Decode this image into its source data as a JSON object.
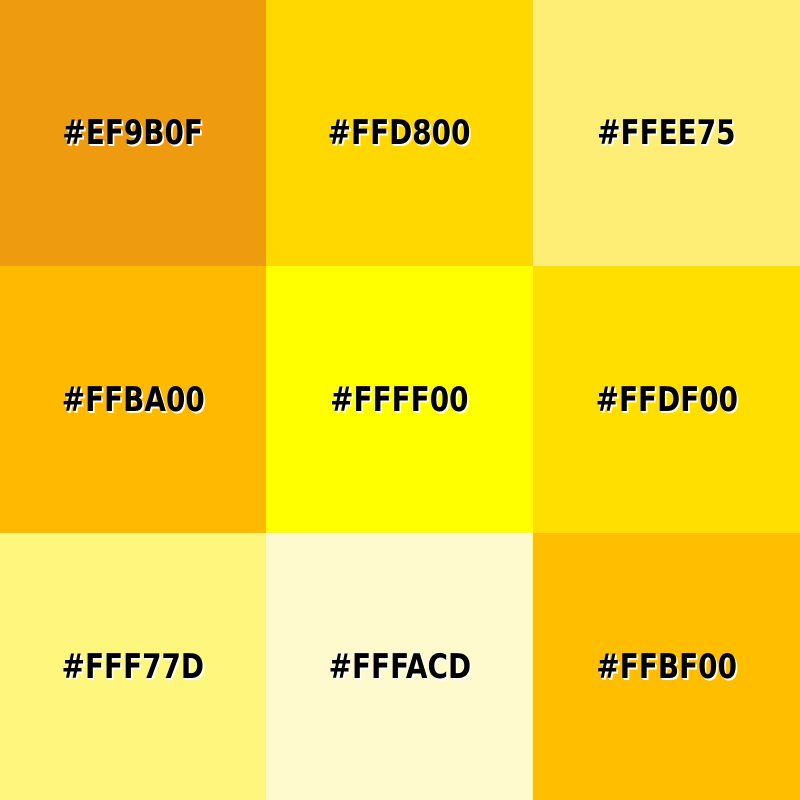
{
  "swatches": [
    {
      "label": "#EF9B0F",
      "color": "#EF9B0F"
    },
    {
      "label": "#FFD800",
      "color": "#FFD800"
    },
    {
      "label": "#FFEE75",
      "color": "#FFEE75"
    },
    {
      "label": "#FFBA00",
      "color": "#FFBA00"
    },
    {
      "label": "#FFFF00",
      "color": "#FFFF00"
    },
    {
      "label": "#FFDF00",
      "color": "#FFDF00"
    },
    {
      "label": "#FFF77D",
      "color": "#FFF77D"
    },
    {
      "label": "#FFFACD",
      "color": "#FFFACD"
    },
    {
      "label": "#FFBF00",
      "color": "#FFBF00"
    }
  ]
}
